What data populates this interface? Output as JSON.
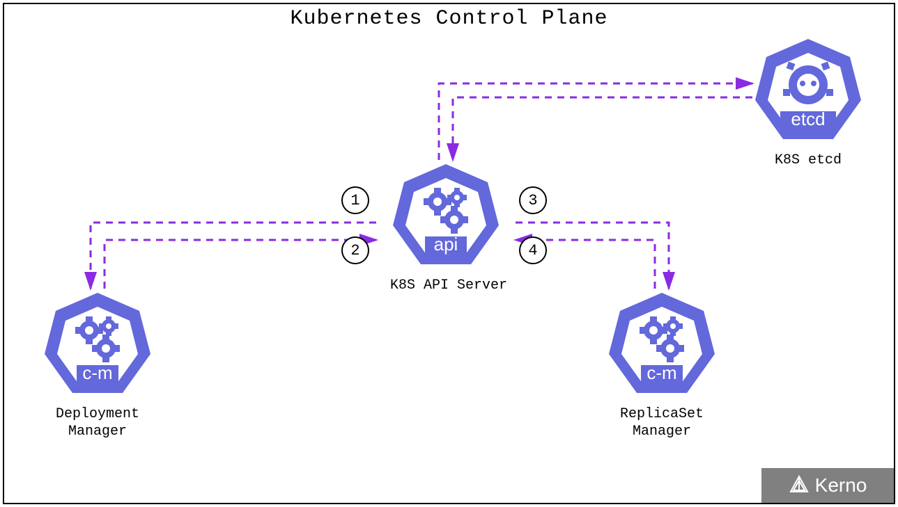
{
  "title": "Kubernetes Control Plane",
  "nodes": {
    "etcd": {
      "label": "K8S etcd",
      "badge": "etcd"
    },
    "api": {
      "label": "K8S API Server",
      "badge": "api"
    },
    "deploy": {
      "label": "Deployment\nManager",
      "badge": "c-m"
    },
    "rs": {
      "label": "ReplicaSet\nManager",
      "badge": "c-m"
    }
  },
  "steps": {
    "s1": "1",
    "s2": "2",
    "s3": "3",
    "s4": "4"
  },
  "brand": "Kerno",
  "colors": {
    "k8s_blue": "#6368db",
    "arrow": "#8a2be2"
  }
}
